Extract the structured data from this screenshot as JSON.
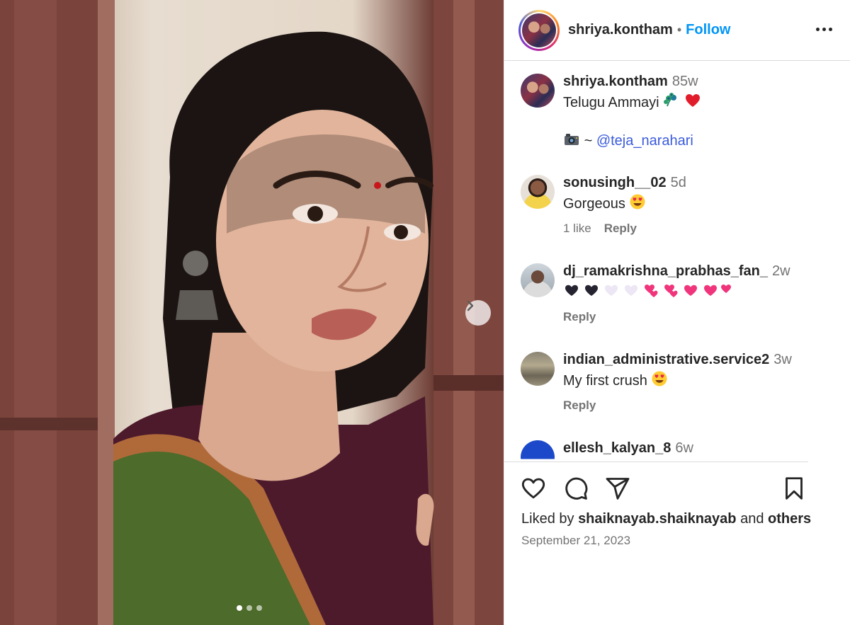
{
  "post": {
    "carousel": {
      "slide_count": 3,
      "active_slide": 1
    }
  },
  "header": {
    "username": "shriya.kontham",
    "separator": "•",
    "follow_label": "Follow"
  },
  "caption": {
    "username": "shriya.kontham",
    "time": "85w",
    "text": "Telugu Ammayi",
    "credit_prefix": "~",
    "mention": "@teja_narahari"
  },
  "comments": [
    {
      "username": "sonusingh__02",
      "time": "5d",
      "text": "Gorgeous",
      "likes": "1 like",
      "reply": "Reply"
    },
    {
      "username": "dj_ramakrishna_prabhas_fan_",
      "time": "2w",
      "text": "",
      "reply": "Reply"
    },
    {
      "username": "indian_administrative.service2",
      "time": "3w",
      "text": "My first crush",
      "reply": "Reply"
    },
    {
      "username": "ellesh_kalyan_8",
      "time": "6w"
    }
  ],
  "likes": {
    "prefix": "Liked by",
    "user": "shaiknayab.shaiknayab",
    "middle": "and",
    "others": "others"
  },
  "date": "September 21, 2023",
  "colors": {
    "follow": "#0095f6",
    "mention": "#3b5bdb",
    "muted": "#737373"
  }
}
